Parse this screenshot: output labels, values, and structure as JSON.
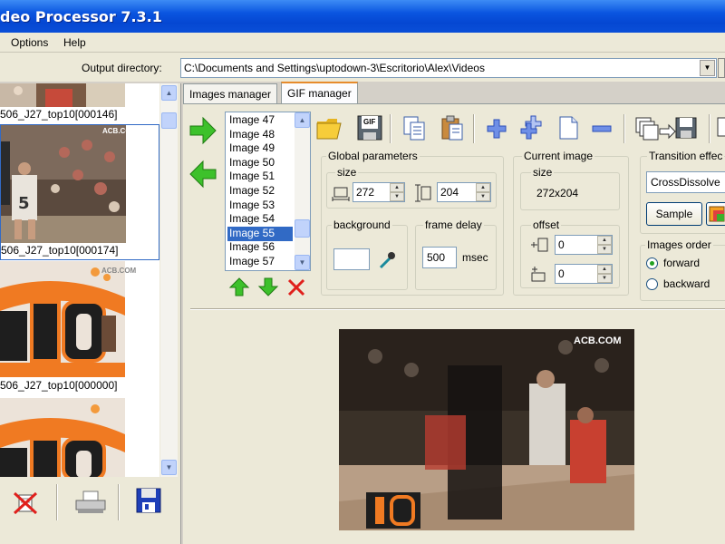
{
  "window": {
    "title": "deo Processor 7.3.1"
  },
  "menu": {
    "options": "Options",
    "help": "Help"
  },
  "output": {
    "label": "Output directory:",
    "path": "C:\\Documents and Settings\\uptodown-3\\Escritorio\\Alex\\Videos"
  },
  "thumbnails": [
    {
      "caption": "506_J27_top10[000146]"
    },
    {
      "caption": "506_J27_top10[000174]"
    },
    {
      "caption": "506_J27_top10[000000]"
    }
  ],
  "thumb_watermark": "ACB.COM",
  "thumb_logo_number": "10",
  "tabs": [
    {
      "label": "Images manager"
    },
    {
      "label": "GIF manager"
    }
  ],
  "image_list": {
    "items": [
      "Image 47",
      "Image 48",
      "Image 49",
      "Image 50",
      "Image 51",
      "Image 52",
      "Image 53",
      "Image 54",
      "Image 55",
      "Image 56",
      "Image 57"
    ],
    "selected": "Image 55"
  },
  "global_params": {
    "title": "Global parameters",
    "size_label": "size",
    "width": "272",
    "height": "204",
    "background_label": "background",
    "frame_delay_label": "frame delay",
    "frame_delay": "500",
    "frame_delay_unit": "msec"
  },
  "current_image": {
    "title": "Current image",
    "size_label": "size",
    "size_value": "272x204",
    "offset_label": "offset",
    "offset_x": "0",
    "offset_y": "0"
  },
  "transition": {
    "title": "Transition effec",
    "effect": "CrossDissolve",
    "sample_label": "Sample"
  },
  "order": {
    "title": "Images order",
    "forward": "forward",
    "backward": "backward",
    "selected": "forward"
  },
  "gif_icon_text": "GIF",
  "preview": {
    "watermark": "ACB.COM",
    "logo_number": "10"
  },
  "colors": {
    "accent": "#316ac5",
    "titlebar": "#0a55e0",
    "tab_highlight": "#e68b2c"
  }
}
